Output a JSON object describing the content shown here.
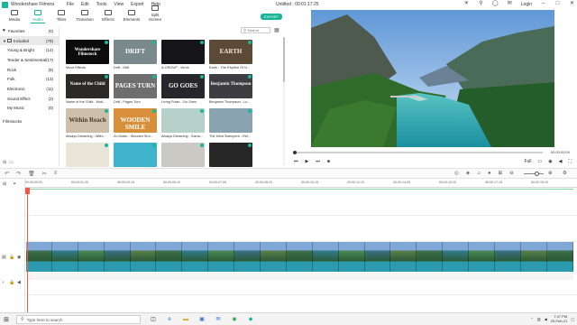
{
  "titlebar": {
    "app_name": "Wondershare Filmora",
    "menus": [
      "File",
      "Edit",
      "Tools",
      "View",
      "Export",
      "Help"
    ],
    "window_title": "Untitled : 00:01:17:25",
    "login": "Login"
  },
  "tabs": [
    {
      "label": "Media",
      "active": false
    },
    {
      "label": "Audio",
      "active": true
    },
    {
      "label": "Titles",
      "active": false
    },
    {
      "label": "Transition",
      "active": false
    },
    {
      "label": "Effects",
      "active": false
    },
    {
      "label": "Elements",
      "active": false
    },
    {
      "label": "Split Screen",
      "active": false
    }
  ],
  "export_label": "EXPORT",
  "sidebar": {
    "favorites": {
      "label": "Favorites",
      "count": "(0)"
    },
    "included": {
      "label": "Included",
      "count": "(78)"
    },
    "items": [
      {
        "label": "Young & Bright",
        "count": "(14)"
      },
      {
        "label": "Tender & Sentimental",
        "count": "(17)"
      },
      {
        "label": "Rock",
        "count": "(8)"
      },
      {
        "label": "Folk",
        "count": "(13)"
      },
      {
        "label": "Electronic",
        "count": "(11)"
      },
      {
        "label": "Sound Effect",
        "count": "(2)"
      },
      {
        "label": "My Music",
        "count": "(0)"
      }
    ],
    "filmstocks": "Filmstocks"
  },
  "search": {
    "placeholder": "Search"
  },
  "media_items": [
    {
      "caption": "Move Effects",
      "thumb_text": "Wondershare Filmstock",
      "bg": "#0c0c0c",
      "color": "#ffffff"
    },
    {
      "caption": "Drift - Drift",
      "thumb_text": "DRIFT",
      "bg": "#7a8a8c",
      "color": "#ffffff"
    },
    {
      "caption": "A-GROUP - Verve",
      "thumb_text": "",
      "bg": "#16161a",
      "color": "#ffffff"
    },
    {
      "caption": "Earth - The Rhythm Of N...",
      "thumb_text": "EARTH",
      "bg": "#5b4a35",
      "color": "#f2e6cf"
    },
    {
      "caption": "Name of the Child - Moti...",
      "thumb_text": "Name of the Child",
      "bg": "#2c2a27",
      "color": "#ffffff"
    },
    {
      "caption": "Drift - Pages Turn",
      "thumb_text": "PAGES TURN",
      "bg": "#6e6e6e",
      "color": "#ffffff"
    },
    {
      "caption": "Living Pulse - Go Goes",
      "thumb_text": "GO GOES",
      "bg": "#27272b",
      "color": "#ffffff"
    },
    {
      "caption": "Benjamin Thompson - Lu...",
      "thumb_text": "Benjamin Thompson",
      "bg": "#3d3d42",
      "color": "#f7f7f7"
    },
    {
      "caption": "Always Dreaming - Withi...",
      "thumb_text": "Within Reach",
      "bg": "#cdbfa9",
      "color": "#4a3a2a"
    },
    {
      "caption": "Zo Music - Wooden Smi...",
      "thumb_text": "WOODEN SMILE",
      "bg": "#d78f3a",
      "color": "#ffffff"
    },
    {
      "caption": "Always Dreaming - Sama...",
      "thumb_text": "",
      "bg": "#b4d0c9",
      "color": "#ffffff"
    },
    {
      "caption": "The Mind Sweepers - Rel...",
      "thumb_text": "",
      "bg": "#8aa3b0",
      "color": "#ffffff"
    },
    {
      "caption": "",
      "thumb_text": "",
      "bg": "#e9e4d8",
      "color": "#ffffff"
    },
    {
      "caption": "",
      "thumb_text": "",
      "bg": "#3fb3c9",
      "color": "#ffffff"
    },
    {
      "caption": "",
      "thumb_text": "",
      "bg": "#cbc9c3",
      "color": "#ffffff"
    },
    {
      "caption": "",
      "thumb_text": "",
      "bg": "#262626",
      "color": "#ffffff"
    }
  ],
  "preview": {
    "time": "00:00:00:00",
    "quality": "Full"
  },
  "timeline": {
    "ruler": [
      "00:00:00:00",
      "00:00:01:20",
      "00:00:03:15",
      "00:00:05:10",
      "00:00:07:05",
      "00:00:08:20",
      "00:00:10:15",
      "00:00:12:10",
      "00:00:14:05",
      "00:00:15:20",
      "00:00:17:15",
      "00:00:19:10"
    ],
    "clip_label": "",
    "clip_frames": 21
  },
  "taskbar": {
    "search_placeholder": "Type here to search",
    "time": "7:47 PM",
    "date": "25-Feb-21"
  }
}
